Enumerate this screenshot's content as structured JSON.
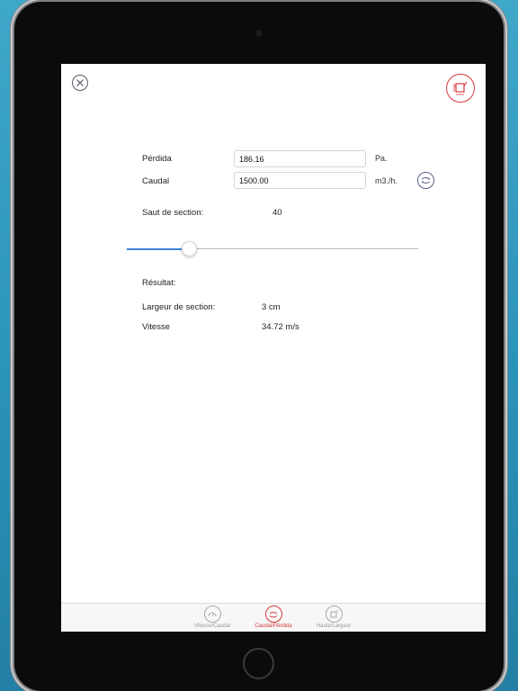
{
  "form": {
    "perdida_label": "Pérdida",
    "perdida_value": "186.16",
    "perdida_unit": "Pa.",
    "caudal_label": "Caudal",
    "caudal_value": "1500.00",
    "caudal_unit": "m3./h."
  },
  "section": {
    "label": "Saut de section:",
    "value": "40",
    "slider_fraction": 0.21
  },
  "result": {
    "title": "Résultat:",
    "largeur_label": "Largeur de section:",
    "largeur_value": "3 cm",
    "vitesse_label": "Vitesse",
    "vitesse_value": "34.72 m/s"
  },
  "tabs": [
    {
      "label": "Vitesse/Caudal",
      "active": false
    },
    {
      "label": "Caudal/Pérdida",
      "active": true
    },
    {
      "label": "Haute/Largeur",
      "active": false
    }
  ],
  "icons": {
    "close": "close-icon",
    "top_right": "section-resize-icon",
    "swap": "swap-icon"
  },
  "colors": {
    "accent": "#d9383e",
    "slider": "#3b82d6",
    "background": "#2a93b8"
  }
}
